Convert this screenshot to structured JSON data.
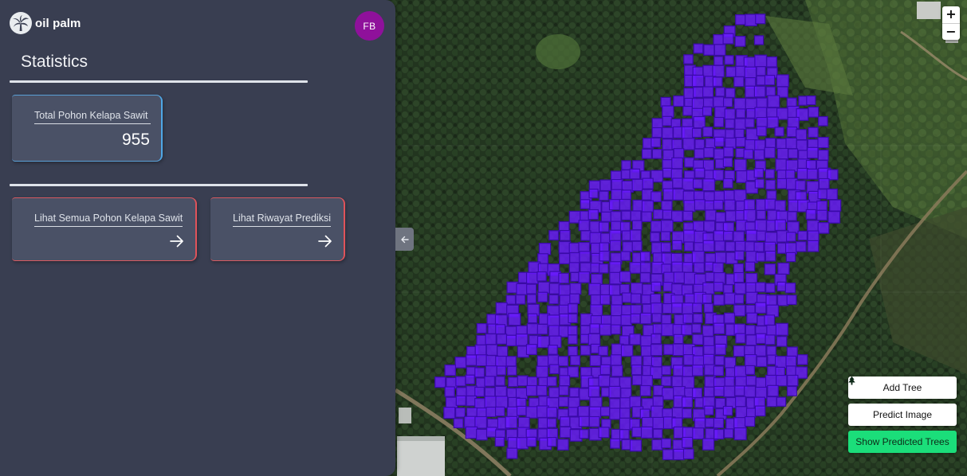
{
  "app": {
    "name": "oil palm",
    "user_initials": "FB"
  },
  "sidebar": {
    "title": "Statistics",
    "stat_card": {
      "label": "Total Pohon Kelapa Sawit",
      "value": "955"
    },
    "links": [
      {
        "label": "Lihat Semua Pohon Kelapa Sawit"
      },
      {
        "label": "Lihat Riwayat Prediksi"
      }
    ]
  },
  "map": {
    "zoom_in": "+",
    "zoom_out": "−",
    "actions": {
      "add_tree": "Add Tree",
      "predict_image": "Predict Image",
      "show_predicted": "Show Predicted Trees"
    },
    "tree_count_visible": 955,
    "box_color": "#6a1bff"
  },
  "colors": {
    "sidebar_bg": "#393e51",
    "card_bg": "#4a5166",
    "stat_accent": "#4fa7e6",
    "link_accent": "#e0535a",
    "avatar_bg": "#8f119b",
    "show_predicted_bg": "#1bde7a"
  },
  "icons": {
    "logo": "palm-tree-icon",
    "link_arrow": "arrow-right-icon",
    "collapse": "arrow-left-icon",
    "action": "tree-icon"
  }
}
